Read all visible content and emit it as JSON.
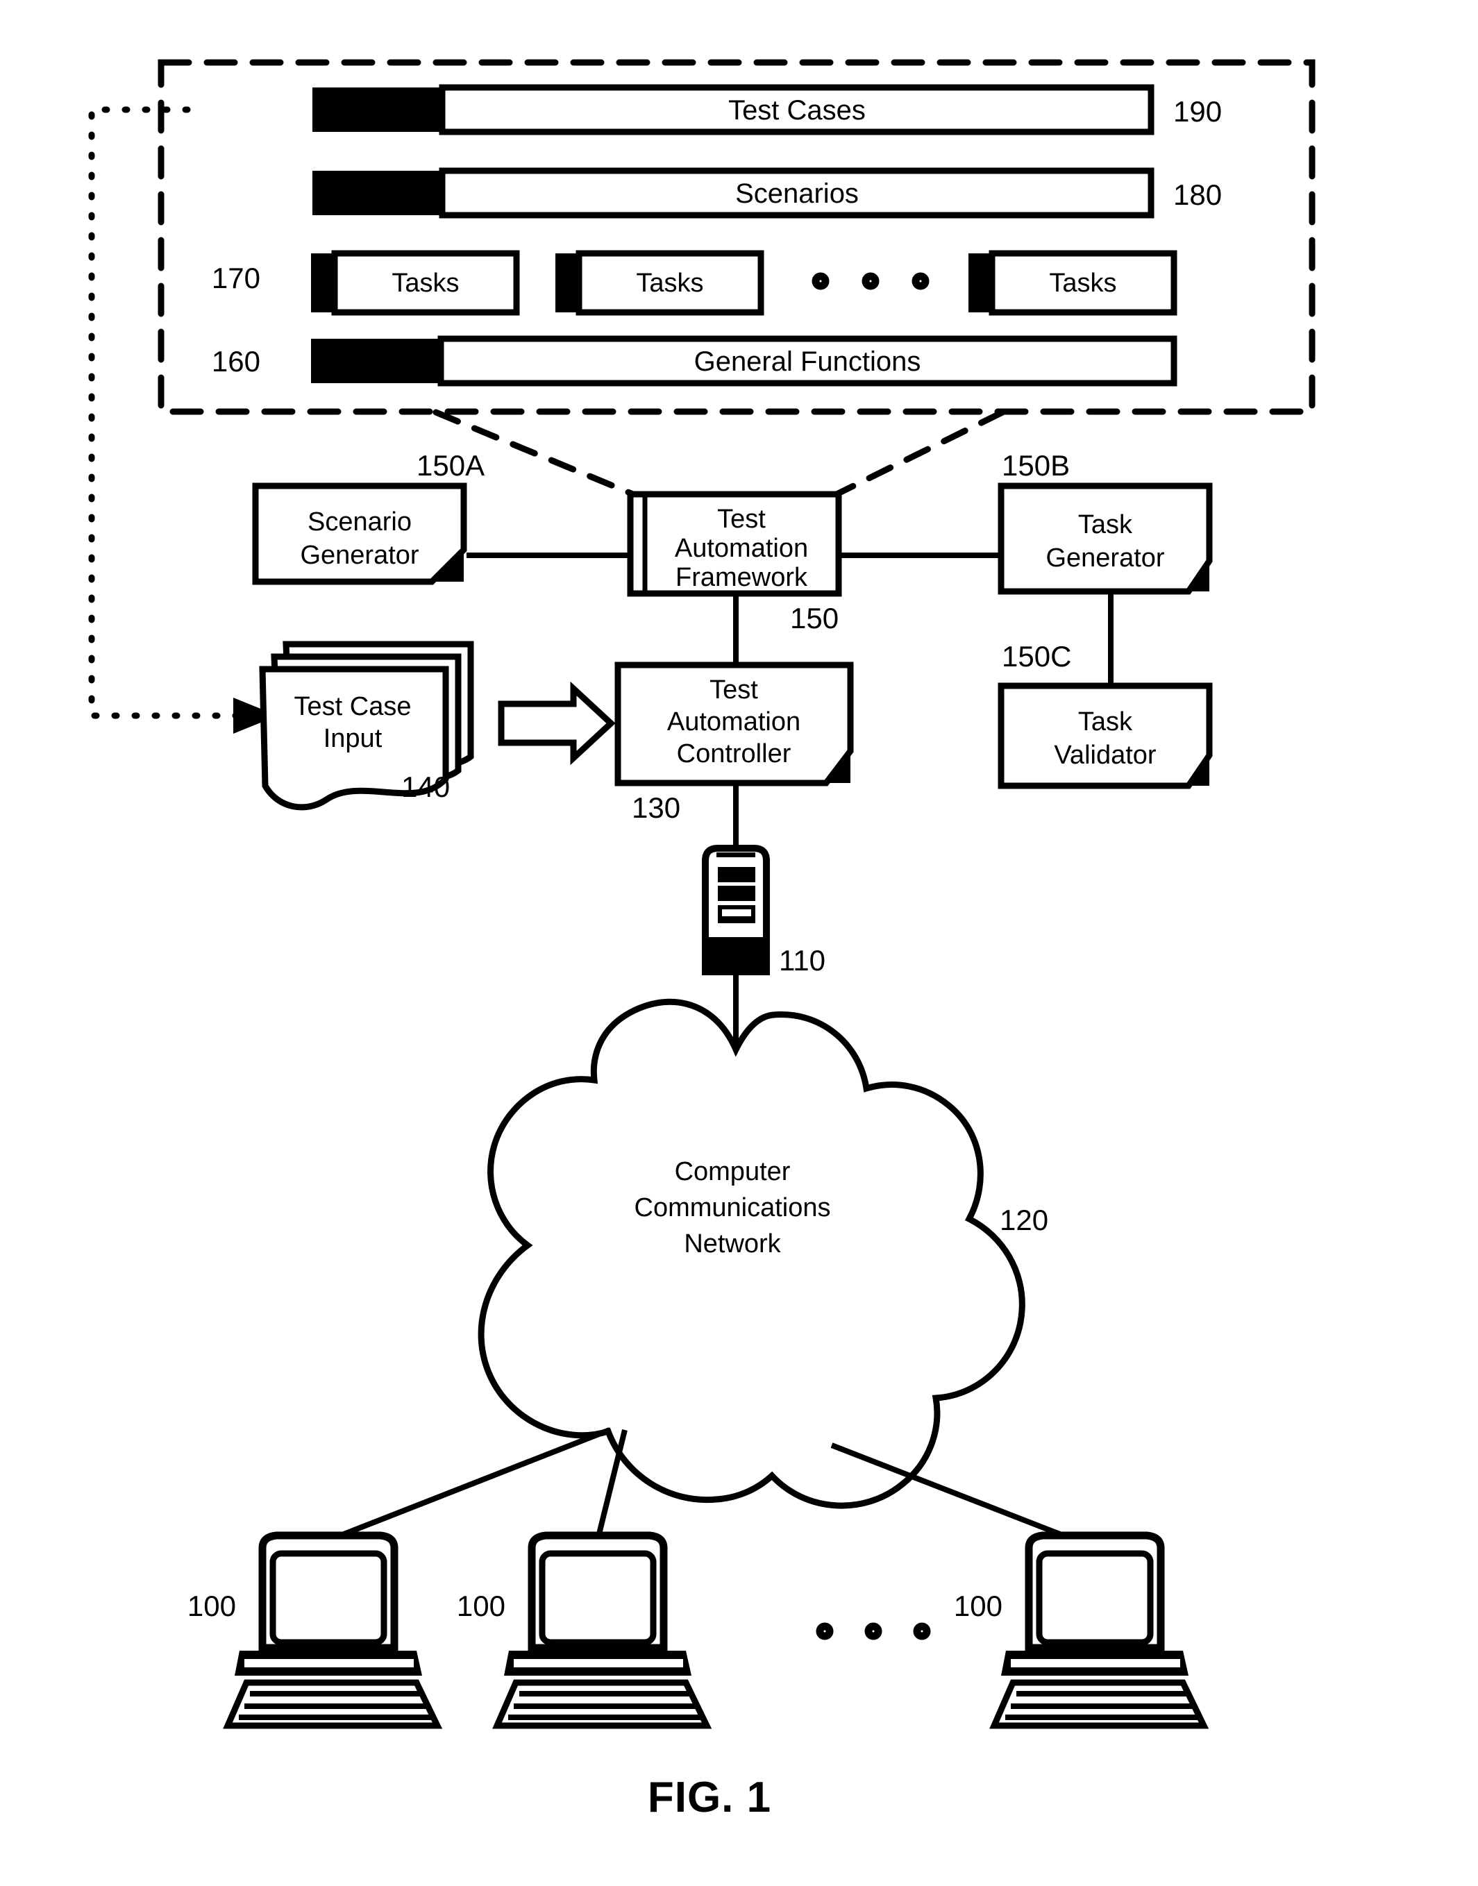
{
  "figure": {
    "caption": "FIG. 1"
  },
  "framework_stack": {
    "ref_container": "",
    "bars": [
      {
        "label": "Test Cases",
        "ref": "190"
      },
      {
        "label": "Scenarios",
        "ref": "180"
      },
      {
        "label": "General Functions",
        "ref": "160"
      }
    ],
    "task_row": {
      "ref": "170",
      "items": [
        {
          "label": "Tasks"
        },
        {
          "label": "Tasks"
        },
        {
          "label": "Tasks"
        }
      ],
      "ellipsis": "o o o"
    }
  },
  "blocks": {
    "scenario_generator": {
      "line1": "Scenario",
      "line2": "Generator",
      "ref": "150A"
    },
    "test_automation_framework": {
      "line1": "Test",
      "line2": "Automation",
      "line3": "Framework",
      "ref": "150"
    },
    "task_generator": {
      "line1": "Task",
      "line2": "Generator",
      "ref": "150B"
    },
    "task_validator": {
      "line1": "Task",
      "line2": "Validator",
      "ref": "150C"
    },
    "test_case_input": {
      "line1": "Test Case",
      "line2": "Input",
      "ref": "140"
    },
    "test_automation_controller": {
      "line1": "Test",
      "line2": "Automation",
      "line3": "Controller",
      "ref": "130"
    },
    "server": {
      "ref": "110"
    },
    "network_cloud": {
      "line1": "Computer",
      "line2": "Communications",
      "line3": "Network",
      "ref": "120"
    },
    "clients": [
      {
        "ref": "100"
      },
      {
        "ref": "100"
      },
      {
        "ref": "100"
      }
    ],
    "client_ellipsis": "o o o"
  },
  "colors": {
    "ink": "#000000",
    "paper": "#ffffff"
  }
}
